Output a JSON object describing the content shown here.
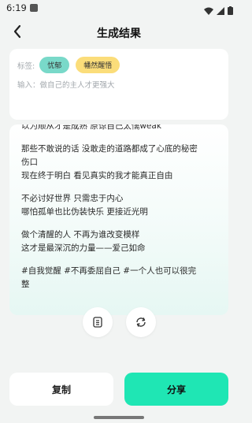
{
  "status": {
    "time": "6:19"
  },
  "header": {
    "title": "生成结果"
  },
  "info": {
    "tag_label": "标签:",
    "tags": [
      "忧郁",
      "幡然醒悟"
    ],
    "input_text": "输入：做自己的主人才更强大"
  },
  "result": {
    "lines": [
      "以为顺从才是成熟 原谅自己太懦weak",
      "",
      "那些不敢说的话 没敢走的道路都成了心底的秘密",
      "伤口",
      "现在终于明白 看见真实的我才能真正自由",
      "",
      "不必讨好世界 只需忠于内心",
      "哪怕孤单也比伪装快乐 更接近光明",
      "",
      "做个清醒的人 不再为谁改变模样",
      "这才是最深沉的力量——爱己如命",
      "",
      "#自我觉醒 #不再委屈自己 #一个人也可以很完",
      "整"
    ]
  },
  "actions": {
    "copy_label": "复制",
    "share_label": "分享"
  }
}
